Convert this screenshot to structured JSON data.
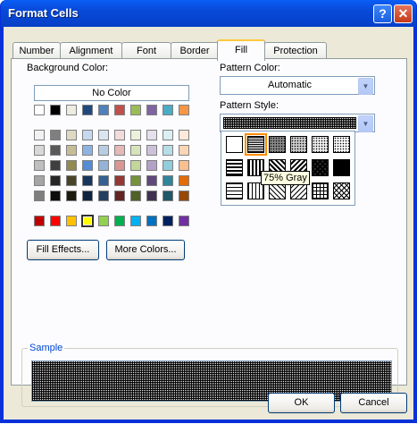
{
  "window": {
    "title": "Format Cells",
    "help": "?",
    "close": "✕"
  },
  "tabs": [
    "Number",
    "Alignment",
    "Font",
    "Border",
    "Fill",
    "Protection"
  ],
  "active_tab": "Fill",
  "background_color": {
    "label": "Background Color:",
    "no_color": "No Color",
    "theme_top": [
      "#ffffff",
      "#000000",
      "#eeece1",
      "#1f497d",
      "#4f81bd",
      "#c0504d",
      "#9bbb59",
      "#8064a2",
      "#4bacc6",
      "#f79646"
    ],
    "theme_tints": [
      [
        "#f2f2f2",
        "#7f7f7f",
        "#ddd9c3",
        "#c6d9f0",
        "#dbe5f1",
        "#f2dcdb",
        "#ebf1dd",
        "#e5e0ec",
        "#dbeef3",
        "#fdeada"
      ],
      [
        "#d8d8d8",
        "#595959",
        "#c4bd97",
        "#8db3e2",
        "#b8cce4",
        "#e5b9b7",
        "#d7e3bc",
        "#ccc1d9",
        "#b7dde8",
        "#fbd5b5"
      ],
      [
        "#bfbfbf",
        "#3f3f3f",
        "#938953",
        "#548dd4",
        "#95b3d7",
        "#d99694",
        "#c3d69b",
        "#b2a2c7",
        "#92cddc",
        "#fac08f"
      ],
      [
        "#a5a5a5",
        "#262626",
        "#494429",
        "#17365d",
        "#366092",
        "#953734",
        "#76923c",
        "#5f497a",
        "#31859b",
        "#e36c09"
      ],
      [
        "#7f7f7f",
        "#0c0c0c",
        "#1d1b10",
        "#0f243e",
        "#244061",
        "#632423",
        "#4f6128",
        "#3f3151",
        "#205867",
        "#974806"
      ]
    ],
    "standard": [
      "#c00000",
      "#ff0000",
      "#ffc000",
      "#ffff00",
      "#92d050",
      "#00b050",
      "#00b0f0",
      "#0070c0",
      "#002060",
      "#7030a0"
    ]
  },
  "fill_effects_label": "Fill Effects...",
  "more_colors_label": "More Colors...",
  "pattern_color": {
    "label": "Pattern Color:",
    "value": "Automatic"
  },
  "pattern_style": {
    "label": "Pattern Style:",
    "tooltip": "75% Gray"
  },
  "sample_label": "Sample",
  "ok_label": "OK",
  "cancel_label": "Cancel"
}
